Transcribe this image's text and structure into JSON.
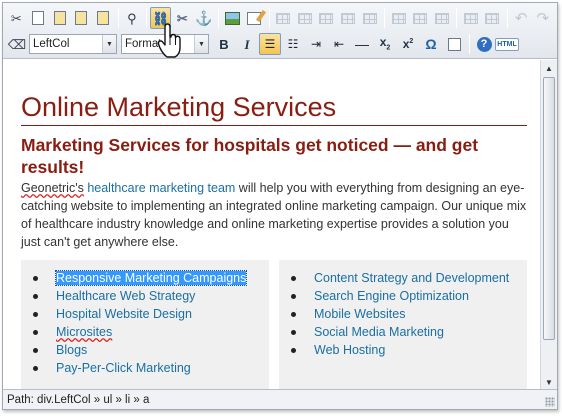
{
  "toolbar": {
    "style_select": "LeftCol",
    "format_select": "Format",
    "row1_icons": [
      "cut-icon",
      "copy-icon",
      "paste-icon",
      "paste-text-icon",
      "paste-word-icon",
      "find-icon",
      "insert-link-icon",
      "unlink-icon",
      "anchor-icon",
      "insert-image-icon",
      "edit-icon",
      "table-icon",
      "table-props-icon",
      "row-icon",
      "cell-icon",
      "merge-icon",
      "col-icon",
      "split-icon",
      "delete-col-icon",
      "table-grid-icon",
      "table-grid2-icon",
      "undo-icon",
      "redo-icon"
    ],
    "bold": "B",
    "italic": "I",
    "subscript": "x",
    "superscript": "x",
    "omega": "Ω",
    "help": "?",
    "html": "HTML"
  },
  "document": {
    "title": "Online Marketing Services",
    "subtitle": "Marketing Services for hospitals get noticed — and get results!",
    "intro_pre": "Geonetric's",
    "intro_link": "healthcare marketing team",
    "intro_post": " will help you with everything from designing an eye-catching website to implementing an integrated online marketing campaign. Our unique mix of healthcare industry knowledge and online marketing expertise provides a solution you just can't get anywhere else.",
    "left_list": [
      "Responsive Marketing Campaigns",
      "Healthcare Web Strategy",
      "Hospital Website Design",
      "Microsites",
      "Blogs",
      "Pay-Per-Click Marketing"
    ],
    "right_list": [
      "Content Strategy and Development",
      "Search Engine Optimization",
      "Mobile Websites",
      "Social Media Marketing",
      "Web Hosting"
    ]
  },
  "status": {
    "path": "Path: div.LeftCol » ul » li » a"
  },
  "colors": {
    "heading": "#8a1d12",
    "link": "#1a6fa3",
    "selection": "#3399ff"
  }
}
